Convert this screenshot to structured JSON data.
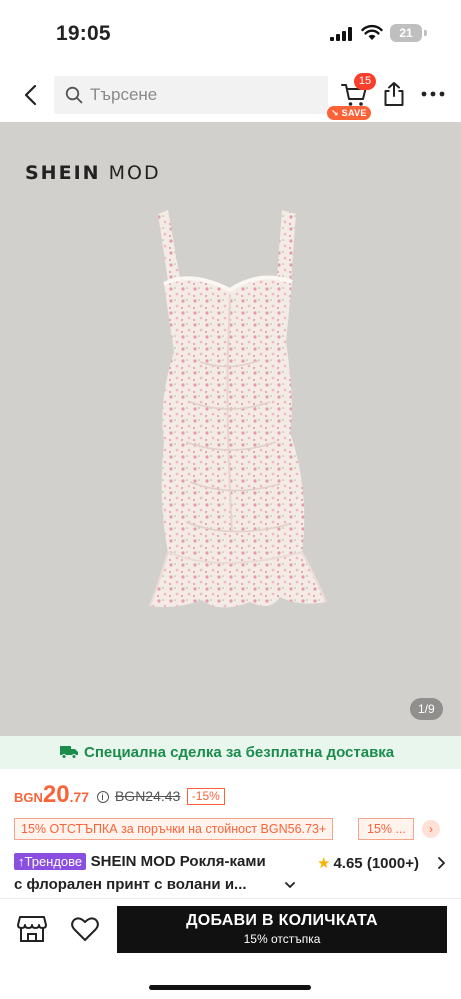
{
  "status_bar": {
    "time": "19:05",
    "battery": "21"
  },
  "header": {
    "search_placeholder": "Търсене",
    "cart_count": "15",
    "save_label": "SAVE"
  },
  "gallery": {
    "brand_prefix": "SHEIN",
    "brand_suffix": "MOD",
    "pager": "1/9"
  },
  "shipping": {
    "text": "Специална сделка за безплатна доставка"
  },
  "price": {
    "currency": "BGN",
    "integer": "20",
    "decimal": ".77",
    "info_glyph": "i",
    "original": "BGN24.43",
    "discount": "-15%"
  },
  "promo": {
    "text": "15% ОТСТЪПКА за поръчки на стойност BGN56.73+",
    "short": "15% ...",
    "arrow": "›"
  },
  "product": {
    "trend_label": "Трендове",
    "title_line1": "SHEIN MOD Рокля-ками",
    "title_line2": "с флорален принт с волани и...",
    "rating": "4.65",
    "reviews": "(1000+)",
    "star": "★"
  },
  "bottom_bar": {
    "add_label": "ДОБАВИ В КОЛИЧКАТА",
    "add_sub": "15% отстъпка"
  },
  "colors": {
    "accent": "#fa6338",
    "green": "#1b8c4c",
    "trend": "#8a4fe0",
    "button": "#111111"
  },
  "icons": [
    "back-icon",
    "search-icon",
    "cart-icon",
    "share-icon",
    "more-icon",
    "truck-icon",
    "info-icon",
    "chevron-right-icon",
    "chevron-down-icon",
    "star-icon",
    "store-icon",
    "heart-icon"
  ]
}
